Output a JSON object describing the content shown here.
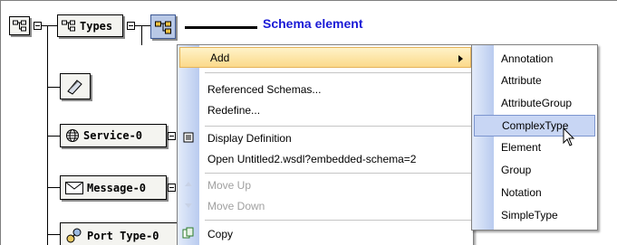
{
  "tree": {
    "root_icon": "schema-tree-icon",
    "types_label": "Types",
    "service_label": "Service-0",
    "message_label": "Message-0",
    "port_type_label": "Port Type-0"
  },
  "callout": {
    "text": "Schema element",
    "color": "#1a1ad6"
  },
  "context_menu": {
    "items": [
      {
        "label": "Add",
        "highlighted": true,
        "has_submenu": true
      },
      {
        "label": "Referenced Schemas..."
      },
      {
        "label": "Redefine..."
      },
      {
        "label": "Display Definition",
        "icon": "definition-icon"
      },
      {
        "label": "Open Untitled2.wsdl?embedded-schema=2"
      },
      {
        "label": "Move Up",
        "disabled": true,
        "icon": "up-arrow-icon"
      },
      {
        "label": "Move Down",
        "disabled": true,
        "icon": "down-arrow-icon"
      },
      {
        "label": "Copy",
        "icon": "copy-icon"
      }
    ]
  },
  "add_submenu": {
    "items": [
      {
        "label": "Annotation"
      },
      {
        "label": "Attribute"
      },
      {
        "label": "AttributeGroup"
      },
      {
        "label": "ComplexType",
        "highlighted": true
      },
      {
        "label": "Element"
      },
      {
        "label": "Group"
      },
      {
        "label": "Notation"
      },
      {
        "label": "SimpleType"
      }
    ]
  },
  "colors": {
    "menu_highlight": "#fbd98a",
    "submenu_highlight": "#c8d6f4",
    "menu_strip": "#b9cbef"
  }
}
